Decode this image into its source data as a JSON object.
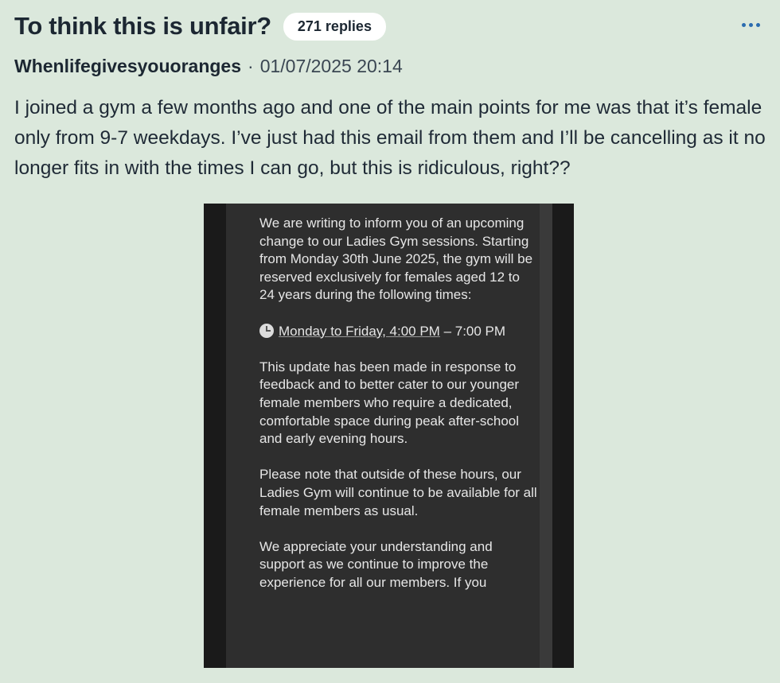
{
  "thread": {
    "title": "To think this is unfair?",
    "replies_badge": "271 replies",
    "more_icon": "ellipsis-icon"
  },
  "post": {
    "author": "Whenlifegivesyouoranges",
    "separator": "·",
    "timestamp": "01/07/2025 20:14",
    "body": "I joined a gym a few months ago and one of the main points for me was that it’s female only from 9-7 weekdays. I’ve just had this email from them and I’ll be cancelling as it no longer fits in with the times I can go, but this is ridiculous, right??"
  },
  "attachment": {
    "paragraph_1": "We are writing to inform you of an upcoming change to our Ladies Gym sessions. Starting from Monday 30th June 2025, the gym will be reserved exclusively for females aged 12 to 24 years during the following times:",
    "clock_icon": "clock-icon",
    "times_line_underlined": "Monday to Friday, 4:00 PM",
    "times_line_rest": " – 7:00 PM",
    "paragraph_3": "This update has been made in response to feedback and to better cater to our younger female members who require a dedicated, comfortable space during peak after-school and early evening hours.",
    "paragraph_4": "Please note that outside of these hours, our Ladies Gym will continue to be available for all female members as usual.",
    "paragraph_5": "We appreciate your understanding and support as we continue to improve the experience for all our members. If you"
  },
  "colors": {
    "page_background": "#dbe8dc",
    "accent": "#2b6cb0",
    "email_background": "#2e2e2e"
  }
}
